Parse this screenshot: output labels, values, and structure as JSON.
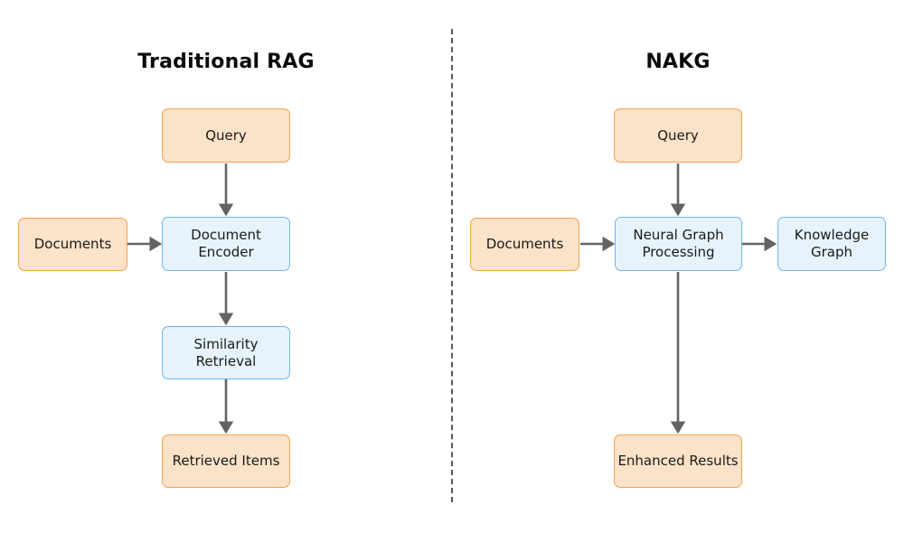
{
  "panels": {
    "left": {
      "title": "Traditional RAG"
    },
    "right": {
      "title": "NAKG"
    }
  },
  "nodes": {
    "rag_query": {
      "label": "Query",
      "type": "input"
    },
    "rag_documents": {
      "label": "Documents",
      "type": "input"
    },
    "rag_document_encoder_line1": {
      "label": "Document"
    },
    "rag_document_encoder_line2": {
      "label": "Encoder"
    },
    "rag_similarity_line1": {
      "label": "Similarity"
    },
    "rag_similarity_line2": {
      "label": "Retrieval"
    },
    "rag_retrieved_items": {
      "label": "Retrieved Items",
      "type": "output"
    },
    "nakg_query": {
      "label": "Query",
      "type": "input"
    },
    "nakg_documents": {
      "label": "Documents",
      "type": "input"
    },
    "nakg_processing_line1": {
      "label": "Neural Graph"
    },
    "nakg_processing_line2": {
      "label": "Processing"
    },
    "nakg_knowledge_graph_line1": {
      "label": "Knowledge"
    },
    "nakg_knowledge_graph_line2": {
      "label": "Graph"
    },
    "nakg_enhanced_results": {
      "label": "Enhanced Results",
      "type": "output"
    }
  },
  "colors": {
    "orange_fill": "#FCE2C8",
    "orange_border": "#F4A14B",
    "blue_fill": "#E6F3FC",
    "blue_border": "#6FB7EE",
    "arrow": "#636363",
    "divider": "#595959",
    "text": "#1a1a1a",
    "title": "#0a0a0a",
    "background": "#ffffff"
  }
}
